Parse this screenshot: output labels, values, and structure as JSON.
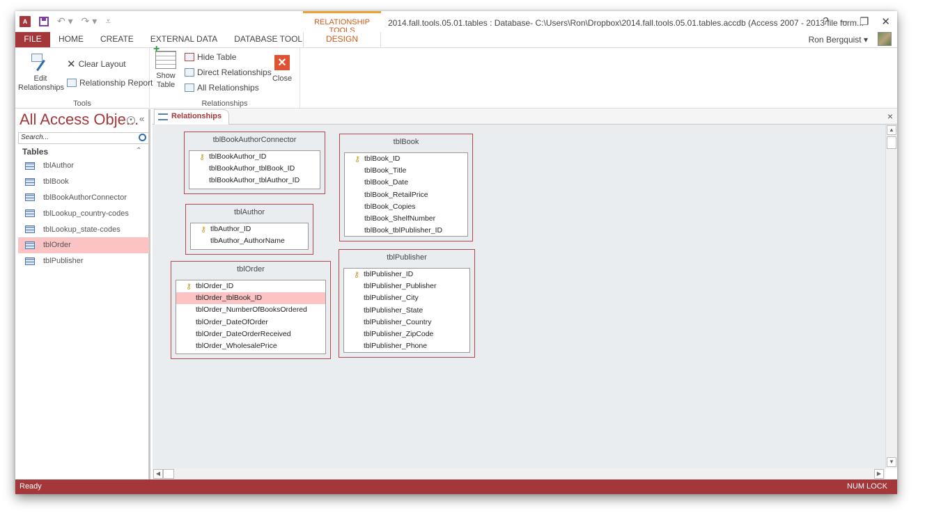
{
  "titlebar": {
    "app_icon": "A",
    "qat_icons": [
      "save-icon",
      "undo-icon",
      "redo-icon",
      "customize-icon"
    ],
    "context_header": "RELATIONSHIP TOOLS",
    "document_title": "2014.fall.tools.05.01.tables : Database- C:\\Users\\Ron\\Dropbox\\2014.fall.tools.05.01.tables.accdb (Access 2007 - 2013 file form...",
    "help": "?",
    "minimize": "–",
    "restore": "❐",
    "close": "✕",
    "user_name": "Ron Bergquist ▾"
  },
  "tabs": [
    {
      "label": "FILE"
    },
    {
      "label": "HOME"
    },
    {
      "label": "CREATE"
    },
    {
      "label": "EXTERNAL DATA"
    },
    {
      "label": "DATABASE TOOLS"
    },
    {
      "label": "DESIGN"
    }
  ],
  "ribbon": {
    "tools": {
      "label": "Tools",
      "edit_relationships": "Edit Relationships",
      "clear_layout": "Clear Layout",
      "relationship_report": "Relationship Report"
    },
    "relationships": {
      "label": "Relationships",
      "show_table_1": "Show",
      "show_table_2": "Table",
      "hide_table": "Hide Table",
      "direct_relationships": "Direct Relationships",
      "all_relationships": "All Relationships",
      "close": "Close"
    },
    "collapse": "^"
  },
  "nav": {
    "title": "All Access Obje...",
    "menu_icon": "▾",
    "shutter": "«",
    "search_placeholder": "Search...",
    "group": "Tables",
    "group_toggle": "⌃",
    "items": [
      {
        "label": "tblAuthor",
        "selected": false
      },
      {
        "label": "tblBook",
        "selected": false
      },
      {
        "label": "tblBookAuthorConnector",
        "selected": false
      },
      {
        "label": "tblLookup_country-codes",
        "selected": false
      },
      {
        "label": "tblLookup_state-codes",
        "selected": false
      },
      {
        "label": "tblOrder",
        "selected": true
      },
      {
        "label": "tblPublisher",
        "selected": false
      }
    ]
  },
  "doc": {
    "tab_label": "Relationships",
    "close": "×"
  },
  "tables": [
    {
      "name": "tblBookAuthorConnector",
      "fields": [
        "tblBookAuthor_ID",
        "tblBookAuthor_tblBook_ID",
        "tblBookAuthor_tblAuthor_ID"
      ],
      "key_index": 0,
      "selected_index": -1
    },
    {
      "name": "tblAuthor",
      "fields": [
        "tlbAuthor_ID",
        "tlbAuthor_AuthorName"
      ],
      "key_index": 0,
      "selected_index": -1
    },
    {
      "name": "tblOrder",
      "fields": [
        "tblOrder_ID",
        "tblOrder_tblBook_ID",
        "tblOrder_NumberOfBooksOrdered",
        "tblOrder_DateOfOrder",
        "tblOrder_DateOrderReceived",
        "tblOrder_WholesalePrice"
      ],
      "key_index": 0,
      "selected_index": 1
    },
    {
      "name": "tblBook",
      "fields": [
        "tblBook_ID",
        "tblBook_Title",
        "tblBook_Date",
        "tblBook_RetailPrice",
        "tblBook_Copies",
        "tblBook_ShelfNumber",
        "tblBook_tblPublisher_ID"
      ],
      "key_index": 0,
      "selected_index": -1
    },
    {
      "name": "tblPublisher",
      "fields": [
        "tblPublisher_ID",
        "tblPublisher_Publisher",
        "tblPublisher_City",
        "tblPublisher_State",
        "tblPublisher_Country",
        "tblPublisher_ZipCode",
        "tblPublisher_Phone"
      ],
      "key_index": 0,
      "selected_index": -1
    }
  ],
  "status": {
    "left": "Ready",
    "right": "NUM LOCK"
  },
  "colors": {
    "accent": "#a4373a",
    "context": "#d05a18",
    "selection": "#fbc3c3"
  }
}
